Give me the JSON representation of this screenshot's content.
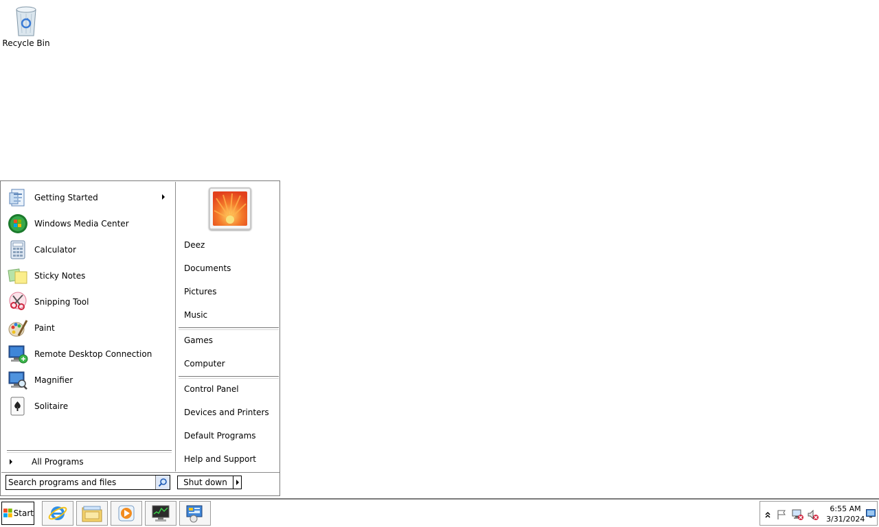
{
  "desktop": {
    "icons": [
      {
        "label": "Recycle Bin",
        "icon": "recycle-bin-icon"
      }
    ]
  },
  "start_menu": {
    "pinned_programs": [
      {
        "label": "Getting Started",
        "icon": "getting-started-icon",
        "has_submenu": true
      },
      {
        "label": "Windows Media Center",
        "icon": "windows-media-center-icon"
      },
      {
        "label": "Calculator",
        "icon": "calculator-icon"
      },
      {
        "label": "Sticky Notes",
        "icon": "sticky-notes-icon"
      },
      {
        "label": "Snipping Tool",
        "icon": "snipping-tool-icon"
      },
      {
        "label": "Paint",
        "icon": "paint-icon"
      },
      {
        "label": "Remote Desktop Connection",
        "icon": "remote-desktop-icon"
      },
      {
        "label": "Magnifier",
        "icon": "magnifier-icon"
      },
      {
        "label": "Solitaire",
        "icon": "solitaire-icon"
      }
    ],
    "all_programs_label": "All Programs",
    "right_links": {
      "user": "Deez",
      "documents": "Documents",
      "pictures": "Pictures",
      "music": "Music",
      "games": "Games",
      "computer": "Computer",
      "control_panel": "Control Panel",
      "devices_printers": "Devices and Printers",
      "default_programs": "Default Programs",
      "help_support": "Help and Support"
    },
    "search": {
      "placeholder": "Search programs and files",
      "value": ""
    },
    "shutdown_label": "Shut down"
  },
  "taskbar": {
    "start_label": "Start",
    "pinned": [
      {
        "icon": "internet-explorer-icon"
      },
      {
        "icon": "windows-explorer-icon"
      },
      {
        "icon": "windows-media-player-icon"
      },
      {
        "icon": "task-manager-icon"
      },
      {
        "icon": "control-panel-icon"
      }
    ],
    "tray": {
      "time": "6:55 AM",
      "date": "3/31/2024",
      "icons": [
        "show-hidden-icons-icon",
        "action-center-flag-icon",
        "network-disconnected-icon",
        "volume-muted-icon"
      ]
    }
  },
  "colors": {
    "menu_border": "#7a7a7a",
    "accent_blue": "#1e5ab4",
    "orange_flower": "#f07020"
  }
}
